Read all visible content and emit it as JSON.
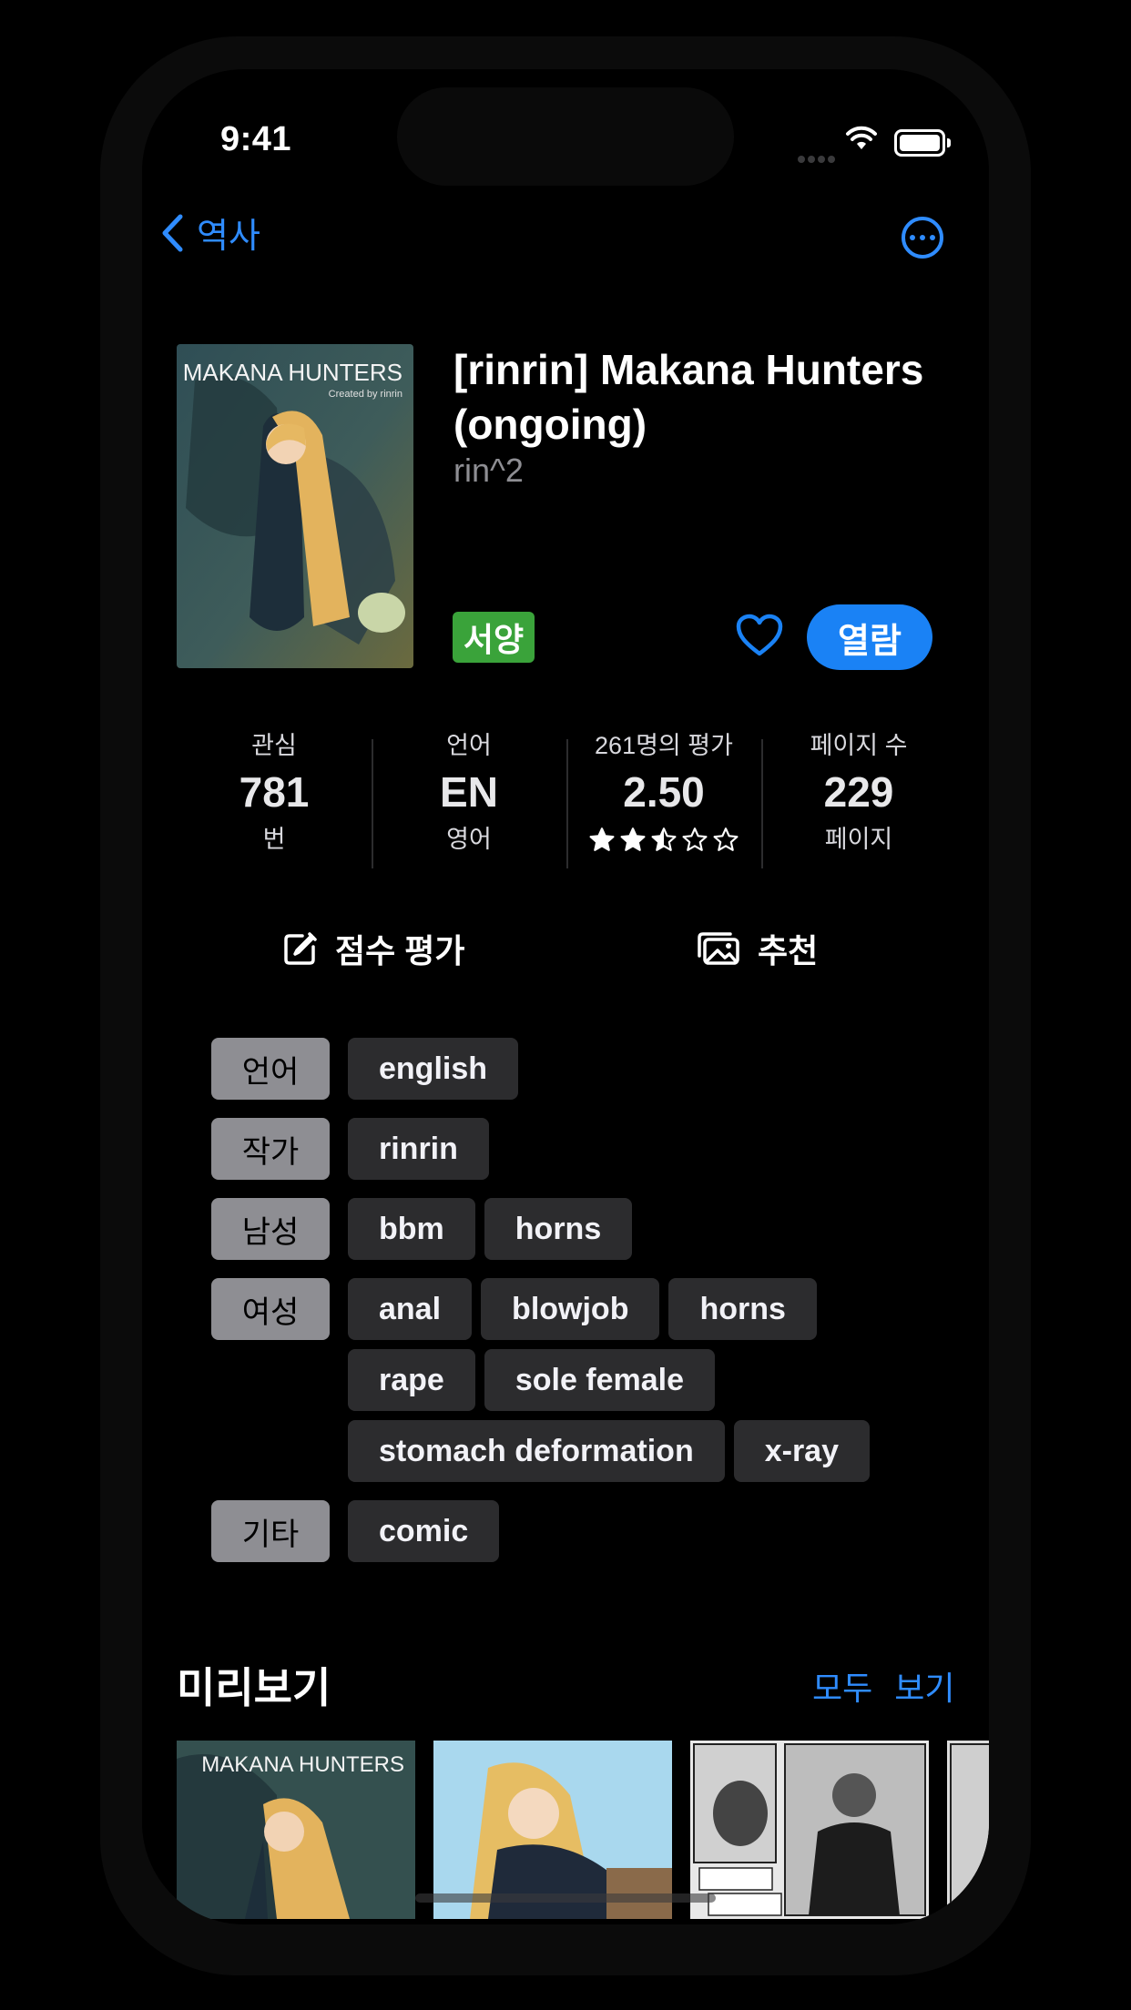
{
  "status_bar": {
    "time": "9:41"
  },
  "nav": {
    "back_label": "역사"
  },
  "gallery": {
    "title": "[rinrin] Makana Hunters (ongoing)",
    "author": "rin^2",
    "category_badge": "서양",
    "open_label": "열람",
    "cover_title": "MAKANA HUNTERS",
    "cover_credit": "Created by rinrin"
  },
  "stats": [
    {
      "label": "관심",
      "value": "781",
      "sub": "번"
    },
    {
      "label": "언어",
      "value": "EN",
      "sub": "영어"
    },
    {
      "label": "261명의 평가",
      "value": "2.50",
      "rating": 2.5
    },
    {
      "label": "페이지 수",
      "value": "229",
      "sub": "페이지"
    }
  ],
  "actions": {
    "rate_label": "점수 평가",
    "recommend_label": "추천"
  },
  "tags": [
    {
      "category": "언어",
      "items": [
        "english"
      ]
    },
    {
      "category": "작가",
      "items": [
        "rinrin"
      ]
    },
    {
      "category": "남성",
      "items": [
        "bbm",
        "horns"
      ]
    },
    {
      "category": "여성",
      "items": [
        "anal",
        "blowjob",
        "horns",
        "rape",
        "sole female",
        "stomach deformation",
        "x-ray"
      ]
    },
    {
      "category": "기타",
      "items": [
        "comic"
      ]
    }
  ],
  "preview": {
    "title": "미리보기",
    "see_all_label": "모두 보기",
    "thumb_title": "MAKANA HUNTERS"
  },
  "colors": {
    "accent": "#1a82f5",
    "badge": "#3aa33a",
    "tag_bg": "#2c2c2e",
    "tag_cat_bg": "#8e8e93"
  }
}
